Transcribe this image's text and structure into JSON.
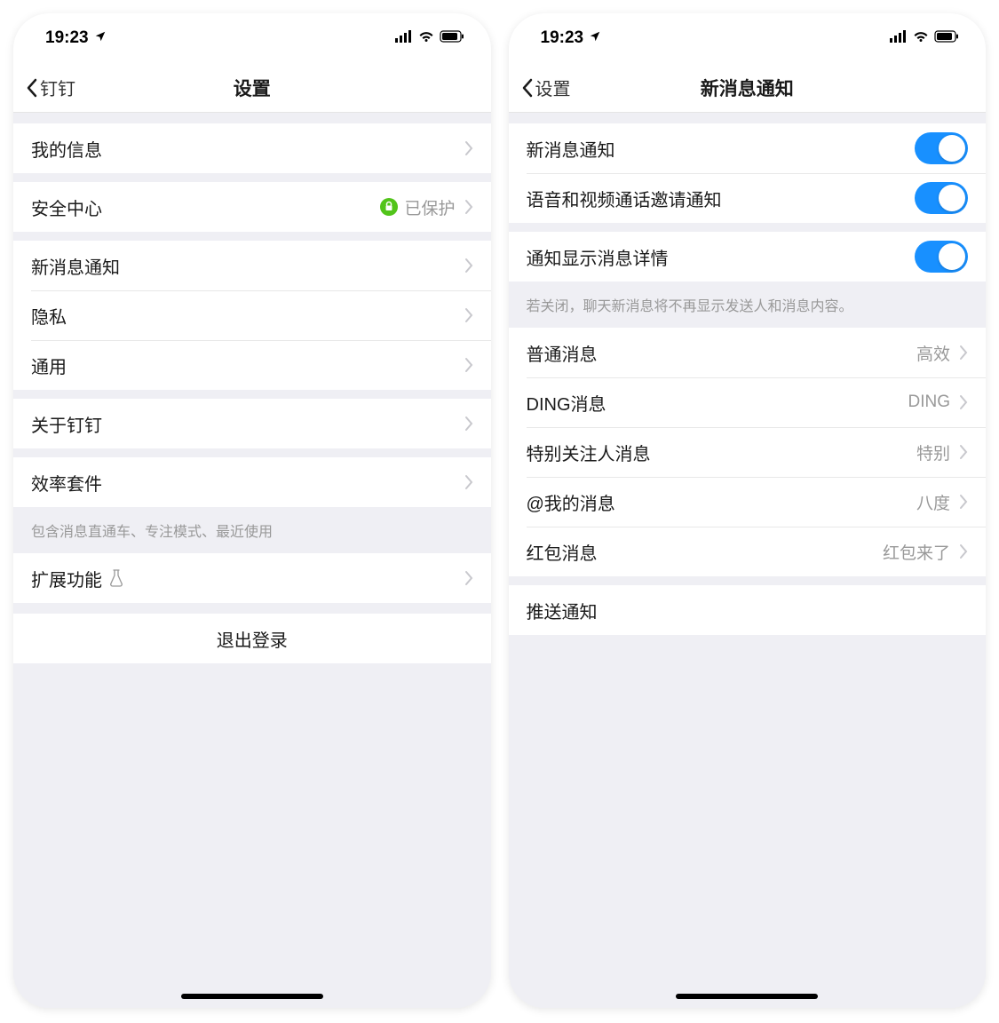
{
  "status_time": "19:23",
  "left": {
    "nav": {
      "back_label": "钉钉",
      "title": "设置"
    },
    "groups": {
      "my_info": "我的信息",
      "security": {
        "label": "安全中心",
        "value": "已保护"
      },
      "notifications": "新消息通知",
      "privacy": "隐私",
      "general": "通用",
      "about": "关于钉钉",
      "efficiency": "效率套件",
      "efficiency_note": "包含消息直通车、专注模式、最近使用",
      "extensions": "扩展功能",
      "logout": "退出登录"
    }
  },
  "right": {
    "nav": {
      "back_label": "设置",
      "title": "新消息通知"
    },
    "toggles": {
      "new_msg": {
        "label": "新消息通知",
        "on": true
      },
      "av_invite": {
        "label": "语音和视频通话邀请通知",
        "on": true
      },
      "show_detail": {
        "label": "通知显示消息详情",
        "on": true
      },
      "show_detail_note": "若关闭，聊天新消息将不再显示发送人和消息内容。"
    },
    "sounds": {
      "normal": {
        "label": "普通消息",
        "value": "高效"
      },
      "ding": {
        "label": "DING消息",
        "value": "DING"
      },
      "special": {
        "label": "特别关注人消息",
        "value": "特别"
      },
      "at_me": {
        "label": "@我的消息",
        "value": "八度"
      },
      "redpacket": {
        "label": "红包消息",
        "value": "红包来了"
      }
    },
    "push": "推送通知"
  }
}
